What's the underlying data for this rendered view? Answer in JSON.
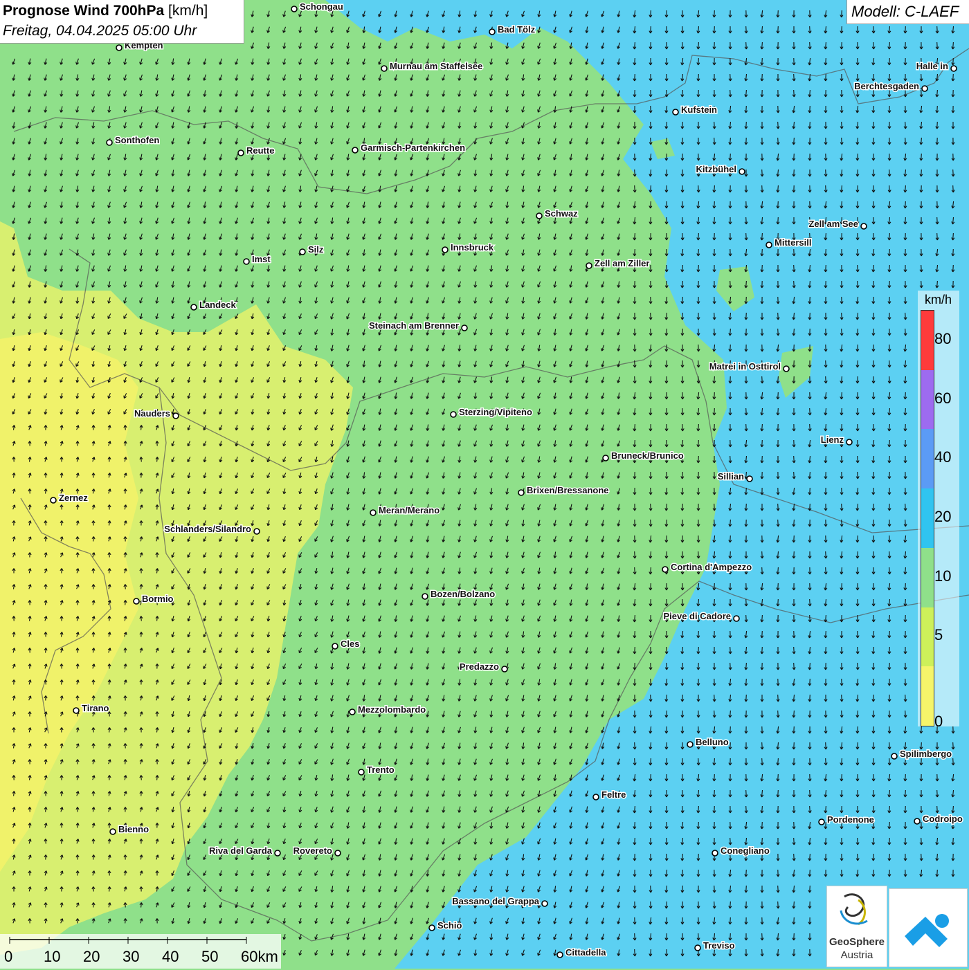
{
  "header": {
    "title_bold": "Prognose Wind 700hPa",
    "title_unit": "[km/h]",
    "datetime": "Freitag, 04.04.2025 05:00 Uhr",
    "model": "Modell: C-LAEF"
  },
  "legend": {
    "unit": "km/h",
    "labels": [
      "80",
      "60",
      "40",
      "20",
      "10",
      "5",
      "0"
    ],
    "colors": [
      "#ff3b3b",
      "#9d6bf0",
      "#5b9bf5",
      "#30c4f0",
      "#8fe08a",
      "#cdf05a",
      "#f5f56a"
    ]
  },
  "scale_bar": {
    "labels": [
      "0",
      "10",
      "20",
      "30",
      "40",
      "50",
      "60km"
    ]
  },
  "cities": [
    {
      "name": "Schongau"
    },
    {
      "name": "Kempten"
    },
    {
      "name": "Bad Tölz"
    },
    {
      "name": "Murnau am Staffelsee"
    },
    {
      "name": "Halle in"
    },
    {
      "name": "Berchtesgaden"
    },
    {
      "name": "Kufstein"
    },
    {
      "name": "Sonthofen"
    },
    {
      "name": "Reutte"
    },
    {
      "name": "Garmisch-Partenkirchen"
    },
    {
      "name": "Kitzbühel"
    },
    {
      "name": "Schwaz"
    },
    {
      "name": "Zell am See"
    },
    {
      "name": "Mittersill"
    },
    {
      "name": "Silz"
    },
    {
      "name": "Innsbruck"
    },
    {
      "name": "Imst"
    },
    {
      "name": "Zell am Ziller"
    },
    {
      "name": "Landeck"
    },
    {
      "name": "Steinach am Brenner"
    },
    {
      "name": "Matrei in Osttirol"
    },
    {
      "name": "Nauders"
    },
    {
      "name": "Sterzing/Vipiteno"
    },
    {
      "name": "Lienz"
    },
    {
      "name": "Bruneck/Brunico"
    },
    {
      "name": "Sillian"
    },
    {
      "name": "Brixen/Bressanone"
    },
    {
      "name": "Zernez"
    },
    {
      "name": "Meran/Merano"
    },
    {
      "name": "Schlanders/Silandro"
    },
    {
      "name": "Cortina d'Ampezzo"
    },
    {
      "name": "Bormio"
    },
    {
      "name": "Bozen/Bolzano"
    },
    {
      "name": "Pieve di Cadore"
    },
    {
      "name": "Cles"
    },
    {
      "name": "Predazzo"
    },
    {
      "name": "Tirano"
    },
    {
      "name": "Mezzolombardo"
    },
    {
      "name": "Belluno"
    },
    {
      "name": "Spilimbergo"
    },
    {
      "name": "Trento"
    },
    {
      "name": "Feltre"
    },
    {
      "name": "Bienno"
    },
    {
      "name": "Pordenone"
    },
    {
      "name": "Codroipo"
    },
    {
      "name": "Riva del Garda"
    },
    {
      "name": "Rovereto"
    },
    {
      "name": "Conegliano"
    },
    {
      "name": "Bassano del Grappa"
    },
    {
      "name": "Schio"
    },
    {
      "name": "Treviso"
    },
    {
      "name": "Cittadella"
    }
  ],
  "logos": {
    "geosphere_line1": "GeoSphere",
    "geosphere_line2": "Austria"
  }
}
